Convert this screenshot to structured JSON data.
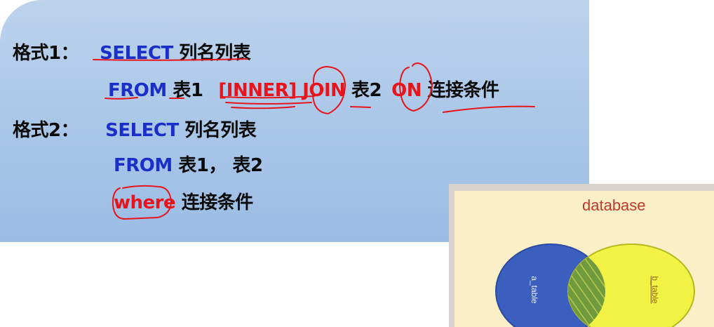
{
  "format1": {
    "label": "格式1：",
    "select": "SELECT",
    "columns": "列名列表",
    "from": "FROM",
    "table1": "表1",
    "inner_join": "[INNER] JOIN",
    "table2": "表2",
    "on": "ON",
    "condition": "连接条件"
  },
  "format2": {
    "label": "格式2：",
    "select": "SELECT",
    "columns": "列名列表",
    "from": "FROM",
    "tables": "表1， 表2",
    "where": "where",
    "condition": "连接条件"
  },
  "diagram": {
    "title": "database",
    "left_set": "a_table",
    "right_set": "b_table",
    "colors": {
      "left": "#3b5fbf",
      "right": "#f2f244",
      "overlap": "#7a9a3a",
      "title": "#c0392b"
    }
  }
}
